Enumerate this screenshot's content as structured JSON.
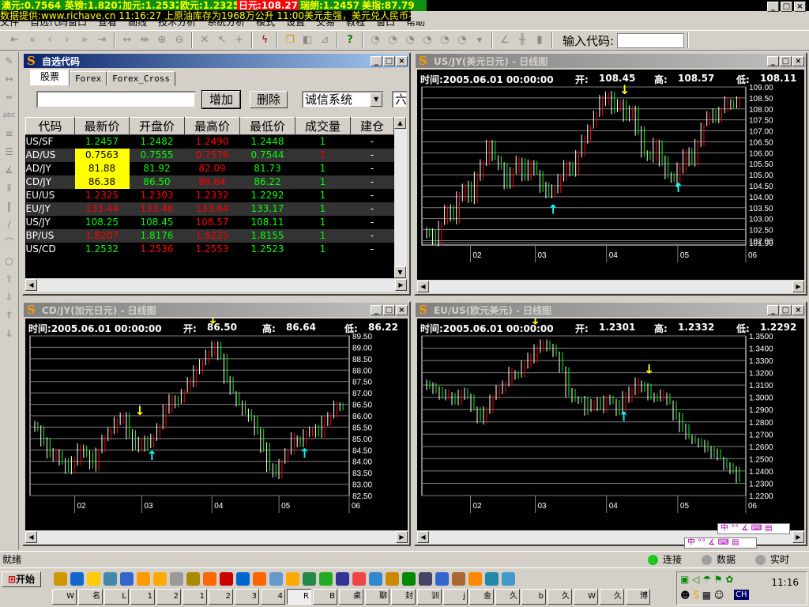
{
  "ticker": [
    {
      "text": "澳元:0.7564",
      "hl": false
    },
    {
      "text": "英镑:1.8207",
      "hl": false
    },
    {
      "text": "加元:1.2532",
      "hl": false
    },
    {
      "text": "欧元:1.2325",
      "hl": false
    },
    {
      "text": "日元:108.27",
      "hl": true
    },
    {
      "text": "瑞朗:1.2457",
      "hl": false
    },
    {
      "text": "美指:87.79",
      "hl": false
    }
  ],
  "news": "数据提供:www.richave.cn    11:16:27  上原油库存为1968万公升  11:00美元走强，美元兑人民币不",
  "menu": [
    "文件",
    "自选代码窗口",
    "查看",
    "画线",
    "技术分析",
    "系统分析",
    "模式",
    "设置",
    "交易",
    "教程",
    "窗口",
    "帮助"
  ],
  "window_controls": {
    "minimize": "_",
    "restore": "□",
    "close": "×"
  },
  "toolbar": {
    "code_label": "输入代码:",
    "code_value": ""
  },
  "watchlist": {
    "title": "自选代码",
    "tabs": [
      "股票",
      "Forex",
      "Forex_Cross"
    ],
    "add_button": "增加",
    "delete_button": "删除",
    "system_select": "诚信系统",
    "extra_select": "六",
    "columns": [
      "代码",
      "最新价",
      "开盘价",
      "最高价",
      "最低价",
      "成交量",
      "建仓",
      "建"
    ],
    "rows": [
      {
        "cells": [
          "US/SF",
          "1.2457",
          "1.2482",
          "1.2490",
          "1.2448",
          "1",
          "-"
        ],
        "colors": [
          "w",
          "g",
          "g",
          "r",
          "g",
          "g",
          "w"
        ],
        "highlight": false
      },
      {
        "cells": [
          "AD/US",
          "0.7563",
          "0.7555",
          "0.7576",
          "0.7544",
          "1",
          "-"
        ],
        "colors": [
          "w",
          "y",
          "g",
          "r",
          "g",
          "r",
          "w"
        ],
        "highlight": true
      },
      {
        "cells": [
          "AD/JY",
          "81.88",
          "81.92",
          "82.09",
          "81.73",
          "1",
          "-"
        ],
        "colors": [
          "w",
          "y",
          "g",
          "r",
          "g",
          "g",
          "w"
        ],
        "highlight": true
      },
      {
        "cells": [
          "CD/JY",
          "86.38",
          "86.50",
          "86.64",
          "86.22",
          "1",
          "-"
        ],
        "colors": [
          "w",
          "y",
          "g",
          "r",
          "g",
          "g",
          "w"
        ],
        "highlight": true
      },
      {
        "cells": [
          "EU/US",
          "1.2325",
          "1.2303",
          "1.2332",
          "1.2292",
          "1",
          "-"
        ],
        "colors": [
          "w",
          "r",
          "r",
          "r",
          "g",
          "g",
          "w"
        ],
        "highlight": false
      },
      {
        "cells": [
          "EU/JY",
          "133.44",
          "133.46",
          "133.64",
          "133.17",
          "1",
          "-"
        ],
        "colors": [
          "w",
          "r",
          "r",
          "r",
          "g",
          "g",
          "w"
        ],
        "highlight": false
      },
      {
        "cells": [
          "US/JY",
          "108.25",
          "108.45",
          "108.57",
          "108.11",
          "1",
          "-"
        ],
        "colors": [
          "w",
          "g",
          "g",
          "r",
          "g",
          "g",
          "w"
        ],
        "highlight": false
      },
      {
        "cells": [
          "BP/US",
          "1.8207",
          "1.8176",
          "1.8225",
          "1.8155",
          "1",
          "-"
        ],
        "colors": [
          "w",
          "r",
          "g",
          "r",
          "g",
          "g",
          "w"
        ],
        "highlight": false
      },
      {
        "cells": [
          "US/CD",
          "1.2532",
          "1.2536",
          "1.2553",
          "1.2523",
          "1",
          "-"
        ],
        "colors": [
          "w",
          "g",
          "r",
          "r",
          "g",
          "g",
          "w"
        ],
        "highlight": false
      }
    ]
  },
  "charts": [
    {
      "title": "US/JY(美元日元) - 日线图",
      "time": "时间:2005.06.01 00:00:00",
      "open_label": "开:",
      "open": "108.45",
      "high_label": "高:",
      "high": "108.57",
      "low_label": "低:",
      "low": "108.11",
      "ylim": [
        101.8,
        109.0
      ],
      "yticks": [
        "109.00",
        "108.50",
        "108.00",
        "107.50",
        "107.00",
        "106.50",
        "106.00",
        "105.50",
        "105.00",
        "104.50",
        "104.00",
        "103.50",
        "103.00",
        "102.50",
        "102.00",
        "101.90"
      ],
      "months": [
        "02",
        "03",
        "04",
        "05",
        "06"
      ],
      "month_pos": [
        0.15,
        0.35,
        0.57,
        0.79,
        1.0
      ],
      "closes": [
        102.3,
        102.0,
        102.8,
        103.5,
        103.0,
        104.0,
        104.5,
        103.8,
        105.0,
        105.5,
        106.5,
        105.8,
        105.3,
        104.6,
        105.2,
        105.6,
        104.9,
        105.5,
        105.1,
        104.4,
        104.0,
        104.3,
        104.9,
        105.4,
        105.0,
        106.0,
        106.6,
        107.2,
        107.8,
        108.4,
        108.6,
        108.0,
        108.3,
        107.6,
        107.9,
        107.0,
        106.0,
        105.8,
        106.5,
        105.6,
        104.9,
        104.7,
        105.3,
        106.0,
        105.6,
        106.5,
        107.3,
        107.8,
        107.5,
        108.0,
        108.3,
        108.1,
        108.3
      ],
      "signals": [
        {
          "index": 21,
          "dir": "up"
        },
        {
          "index": 33,
          "dir": "down"
        },
        {
          "index": 42,
          "dir": "up"
        }
      ]
    },
    {
      "title": "CD/JY(加元日元) - 日线图",
      "time": "时间:2005.06.01 00:00:00",
      "open_label": "开:",
      "open": "86.50",
      "high_label": "高:",
      "high": "86.64",
      "low_label": "低:",
      "low": "86.22",
      "ylim": [
        82.5,
        89.5
      ],
      "yticks": [
        "89.50",
        "89.00",
        "88.50",
        "88.00",
        "87.50",
        "87.00",
        "86.50",
        "86.00",
        "85.50",
        "85.00",
        "84.50",
        "84.00",
        "83.50",
        "83.00",
        "82.50"
      ],
      "months": [
        "02",
        "03",
        "04",
        "05",
        "06"
      ],
      "month_pos": [
        0.14,
        0.35,
        0.57,
        0.78,
        1.0
      ],
      "closes": [
        85.5,
        84.8,
        84.2,
        84.4,
        84.0,
        83.6,
        84.0,
        84.6,
        84.3,
        83.8,
        84.5,
        85.1,
        85.4,
        85.8,
        85.9,
        85.2,
        84.6,
        85.0,
        84.7,
        85.1,
        85.6,
        86.3,
        86.8,
        86.6,
        87.1,
        87.5,
        88.0,
        88.4,
        88.8,
        89.0,
        88.6,
        87.6,
        87.0,
        86.5,
        86.2,
        85.8,
        85.4,
        84.6,
        83.8,
        83.4,
        84.0,
        84.4,
        85.0,
        84.7,
        85.2,
        85.4,
        85.3,
        85.8,
        86.0,
        86.4,
        86.3
      ],
      "signals": [
        {
          "index": 17,
          "dir": "down"
        },
        {
          "index": 19,
          "dir": "up"
        },
        {
          "index": 29,
          "dir": "down"
        },
        {
          "index": 44,
          "dir": "up"
        }
      ]
    },
    {
      "title": "EU/US(欧元美元) - 日线图",
      "time": "时间:2005.06.01 00:00:00",
      "open_label": "开:",
      "open": "1.2301",
      "high_label": "高:",
      "high": "1.2332",
      "low_label": "低:",
      "low": "1.2292",
      "ylim": [
        1.22,
        1.35
      ],
      "yticks": [
        "1.3500",
        "1.3400",
        "1.3300",
        "1.3200",
        "1.3100",
        "1.3000",
        "1.2900",
        "1.2800",
        "1.2700",
        "1.2600",
        "1.2500",
        "1.2400",
        "1.2300",
        "1.2200"
      ],
      "months": [
        "02",
        "03",
        "04",
        "05",
        "06"
      ],
      "month_pos": [
        0.15,
        0.35,
        0.57,
        0.79,
        1.0
      ],
      "closes": [
        1.31,
        1.305,
        1.3,
        1.302,
        1.298,
        1.305,
        1.3,
        1.29,
        1.282,
        1.29,
        1.3,
        1.305,
        1.312,
        1.32,
        1.318,
        1.325,
        1.332,
        1.34,
        1.345,
        1.342,
        1.335,
        1.322,
        1.305,
        1.298,
        1.296,
        1.29,
        1.295,
        1.292,
        1.3,
        1.296,
        1.29,
        1.3,
        1.306,
        1.312,
        1.308,
        1.3,
        1.298,
        1.302,
        1.295,
        1.285,
        1.276,
        1.268,
        1.265,
        1.262,
        1.258,
        1.255,
        1.25,
        1.245,
        1.24,
        1.232
      ],
      "signals": [
        {
          "index": 17,
          "dir": "down"
        },
        {
          "index": 31,
          "dir": "up"
        },
        {
          "index": 35,
          "dir": "down"
        }
      ]
    }
  ],
  "status": {
    "ready": "就绪",
    "connect": "连接",
    "data": "数据",
    "realtime": "实时",
    "colors": {
      "connect": "#1ec81e",
      "off": "#a0a0a0"
    }
  },
  "taskbar": {
    "start": "开始",
    "clock": "11:16",
    "ime": "CH",
    "ime_bar": "中 °° ∡ ⌨ ▤",
    "tasks": [
      "W",
      "名",
      "L",
      "1",
      "2",
      "1",
      "2",
      "3",
      "4",
      "R",
      "B",
      "桌",
      "聊",
      "封",
      "训",
      "j",
      "金",
      "久",
      "b",
      "久",
      "W",
      "久",
      "博"
    ],
    "active_task": 9
  }
}
